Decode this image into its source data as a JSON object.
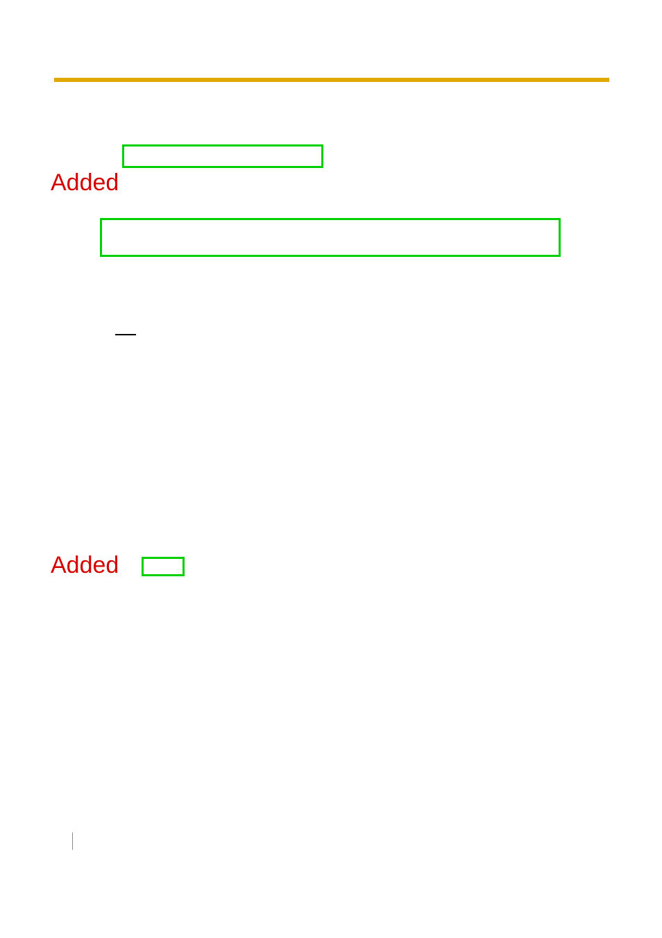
{
  "labels": {
    "added1": "Added",
    "added2": "Added"
  }
}
